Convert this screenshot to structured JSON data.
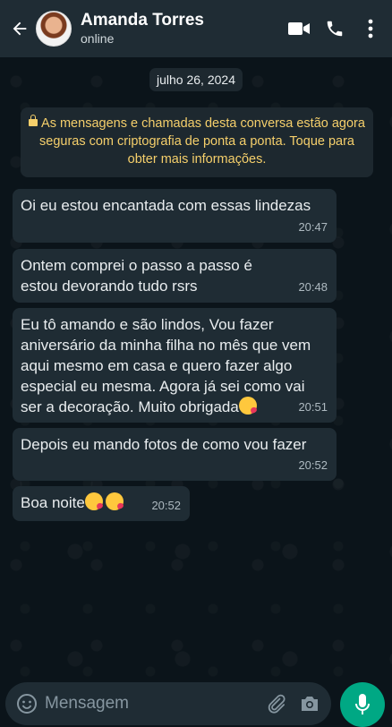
{
  "header": {
    "contact_name": "Amanda Torres",
    "status": "online"
  },
  "chat": {
    "date_chip": "julho 26, 2024",
    "encryption_notice": "As mensagens e chamadas desta conversa estão agora seguras com criptografia de ponta a ponta. Toque para obter mais informações.",
    "messages": [
      {
        "text": "Oi eu estou encantada com essas lindezas",
        "time": "20:47"
      },
      {
        "text": "Ontem comprei o passo a passo é estou devorando tudo rsrs",
        "time": "20:48"
      },
      {
        "text": "Eu tô amando e são lindos, Vou fazer aniversário da minha filha no mês que vem aqui mesmo em casa e quero fazer algo especial eu mesma. Agora já sei como vai ser a decoração. Muito obrigada",
        "time": "20:51"
      },
      {
        "text": "Depois eu mando fotos de como vou fazer",
        "time": "20:52"
      },
      {
        "text": "Boa noite",
        "time": "20:52"
      }
    ]
  },
  "composer": {
    "placeholder": "Mensagem"
  },
  "icons": {
    "back": "arrow-left-icon",
    "video": "video-call-icon",
    "call": "phone-icon",
    "menu": "more-vert-icon",
    "emoji": "emoji-icon",
    "attach": "attach-icon",
    "camera": "camera-icon",
    "mic": "mic-icon",
    "kiss": "kiss-emoji-icon"
  },
  "colors": {
    "header_bg": "#1f2c34",
    "chat_bg": "#0b141a",
    "bubble_bg": "#1f2c34",
    "notice_text": "#f5cf6b",
    "accent": "#00a884"
  }
}
